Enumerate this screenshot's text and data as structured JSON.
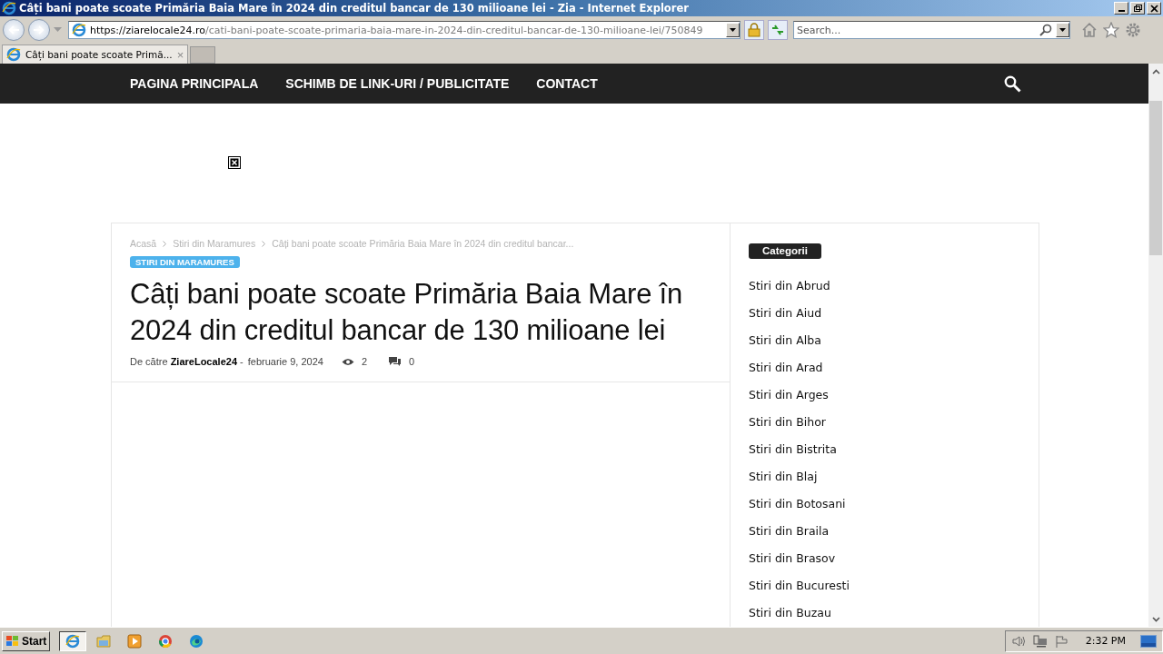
{
  "window": {
    "title": "Câți bani poate scoate Primăria Baia Mare în 2024 din creditul bancar de 130 milioane lei - Zia - Internet Explorer"
  },
  "address": {
    "url_host": "https://ziarelocale24.ro",
    "url_path": "/cati-bani-poate-scoate-primaria-baia-mare-in-2024-din-creditul-bancar-de-130-milioane-lei/750849"
  },
  "search": {
    "placeholder": "Search..."
  },
  "tabs": [
    {
      "label": "Câți bani poate scoate Primă...",
      "close": "×",
      "selected": true
    }
  ],
  "nav": {
    "items": [
      "PAGINA PRINCIPALA",
      "SCHIMB DE LINK-URI / PUBLICITATE",
      "CONTACT"
    ]
  },
  "article": {
    "breadcrumbs": [
      "Acasă",
      "Stiri din Maramures",
      "Câți bani poate scoate Primăria Baia Mare în 2024 din creditul bancar..."
    ],
    "category": "STIRI DIN MARAMURES",
    "title": "Câți bani poate scoate Primăria Baia Mare în 2024 din creditul bancar de 130 milioane lei",
    "byline": "De către **ZiareLocale24** -",
    "date": "februarie 9, 2024",
    "views": "2",
    "comments": "0"
  },
  "sidebar": {
    "title": "Categorii",
    "items": [
      "Stiri din Abrud",
      "Stiri din Aiud",
      "Stiri din Alba",
      "Stiri din Arad",
      "Stiri din Arges",
      "Stiri din Bihor",
      "Stiri din Bistrita",
      "Stiri din Blaj",
      "Stiri din Botosani",
      "Stiri din Braila",
      "Stiri din Brasov",
      "Stiri din Bucuresti",
      "Stiri din Buzau"
    ]
  },
  "taskbar": {
    "start": "Start",
    "apps": [
      {
        "kind": "ie",
        "selected": true
      },
      {
        "kind": "folder",
        "selected": false
      },
      {
        "kind": "media",
        "selected": false
      },
      {
        "kind": "chrome",
        "selected": false
      },
      {
        "kind": "edge",
        "selected": false
      }
    ],
    "clock": "2:32 PM"
  }
}
